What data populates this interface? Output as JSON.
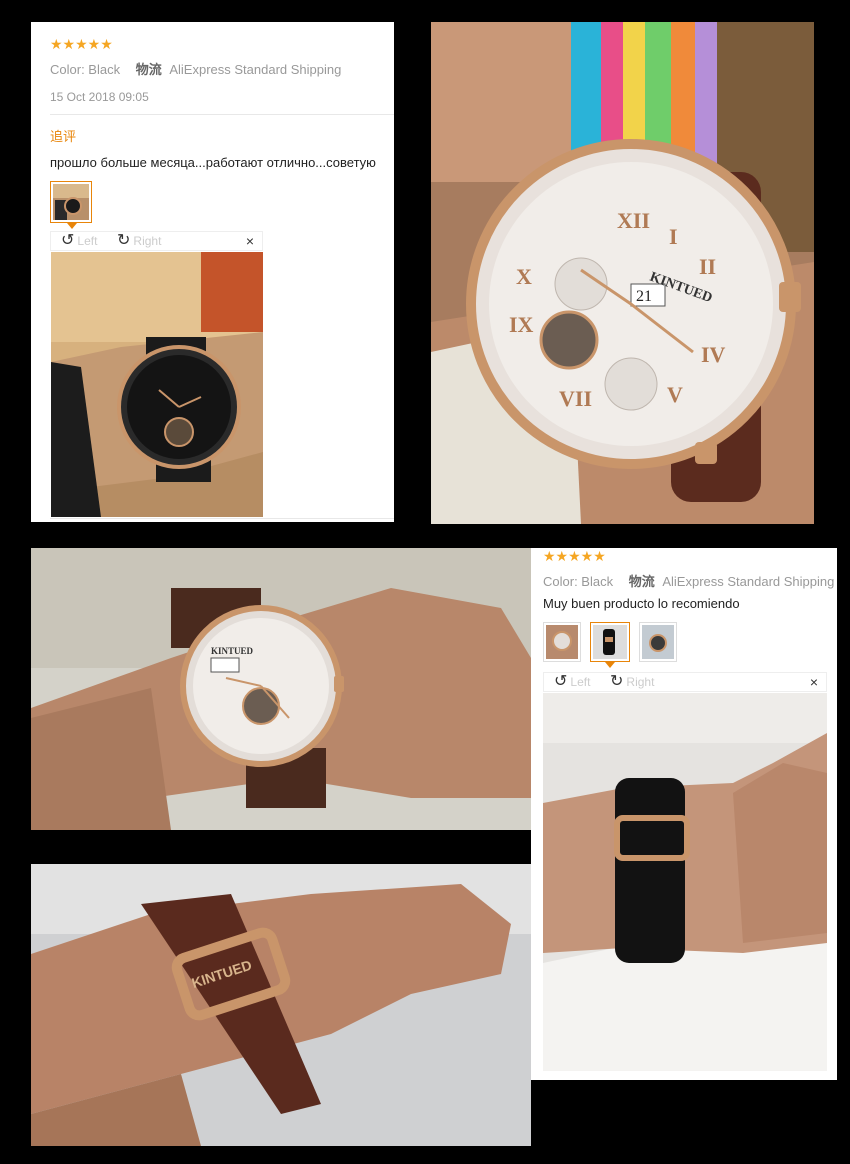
{
  "review1": {
    "rating_stars": "★★★★★",
    "color_label": "Color: Black",
    "logistics_label": "物流",
    "shipping": "AliExpress Standard Shipping",
    "date": "15 Oct 2018 09:05",
    "followup_label": "追评",
    "text": "прошло больше месяца...работают отлично...советую",
    "viewer": {
      "left_label": "Left",
      "right_label": "Right",
      "close": "×"
    }
  },
  "review2": {
    "rating_stars": "★★★★★",
    "color_label": "Color: Black",
    "logistics_label": "物流",
    "shipping": "AliExpress Standard Shipping",
    "text": "Muy buen producto lo recomiendo",
    "viewer": {
      "left_label": "Left",
      "right_label": "Right",
      "close": "×"
    }
  },
  "photos": {
    "main_brand": "KINTUED",
    "date_window": "21",
    "wrist_brand": "KINTUED",
    "buckle_brand": "KINTUED"
  },
  "colors": {
    "star": "#f5a623",
    "accent": "#e8850a",
    "rose_gold": "#c9956a",
    "background": "#000000"
  }
}
